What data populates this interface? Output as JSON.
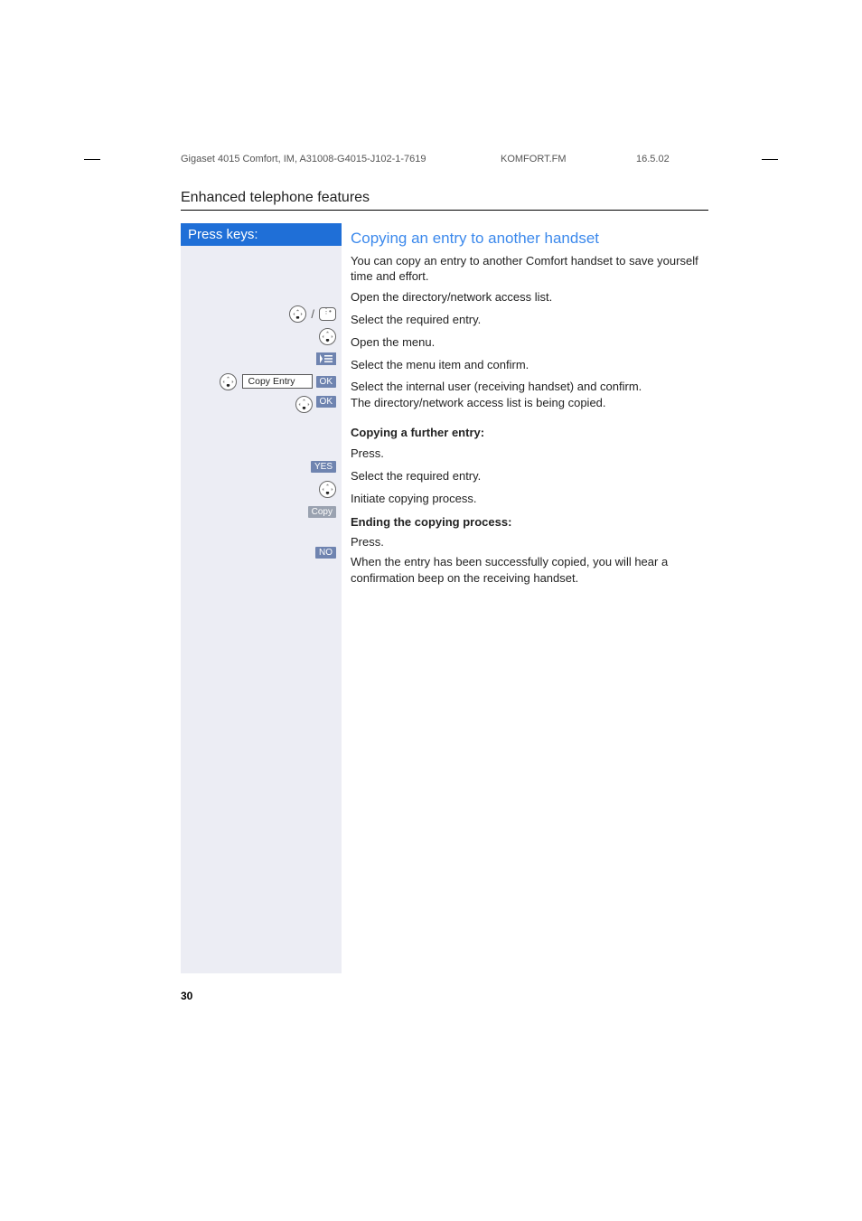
{
  "header": {
    "doc_id": "Gigaset 4015 Comfort, IM, A31008-G4015-J102-1-7619",
    "file": "KOMFORT.FM",
    "date": "16.5.02"
  },
  "section_title": "Enhanced telephone features",
  "keys_header": "Press keys:",
  "subheading": "Copying an entry to another handset",
  "intro": "You can copy an entry to another Comfort handset to save yourself time and effort.",
  "steps": {
    "open_dir": "Open the directory/network access list.",
    "select_entry": "Select the required entry.",
    "open_menu": "Open the menu.",
    "copy_entry_label": "Copy Entry",
    "select_confirm": "Select the menu item and confirm.",
    "select_user_1": "Select the internal user (receiving handset) and confirm.",
    "select_user_2": "The directory/network access list is being copied."
  },
  "further_heading": "Copying a further entry:",
  "further": {
    "press1": "Press.",
    "select": "Select the required entry.",
    "copy": "Initiate copying process."
  },
  "ending_heading": "Ending the copying process:",
  "ending": {
    "press": "Press.",
    "after": "When the entry has been successfully copied, you will hear a confirmation beep on the receiving handset."
  },
  "softkeys": {
    "ok": "OK",
    "yes": "YES",
    "no": "NO",
    "copy": "Copy"
  },
  "page_number": "30"
}
